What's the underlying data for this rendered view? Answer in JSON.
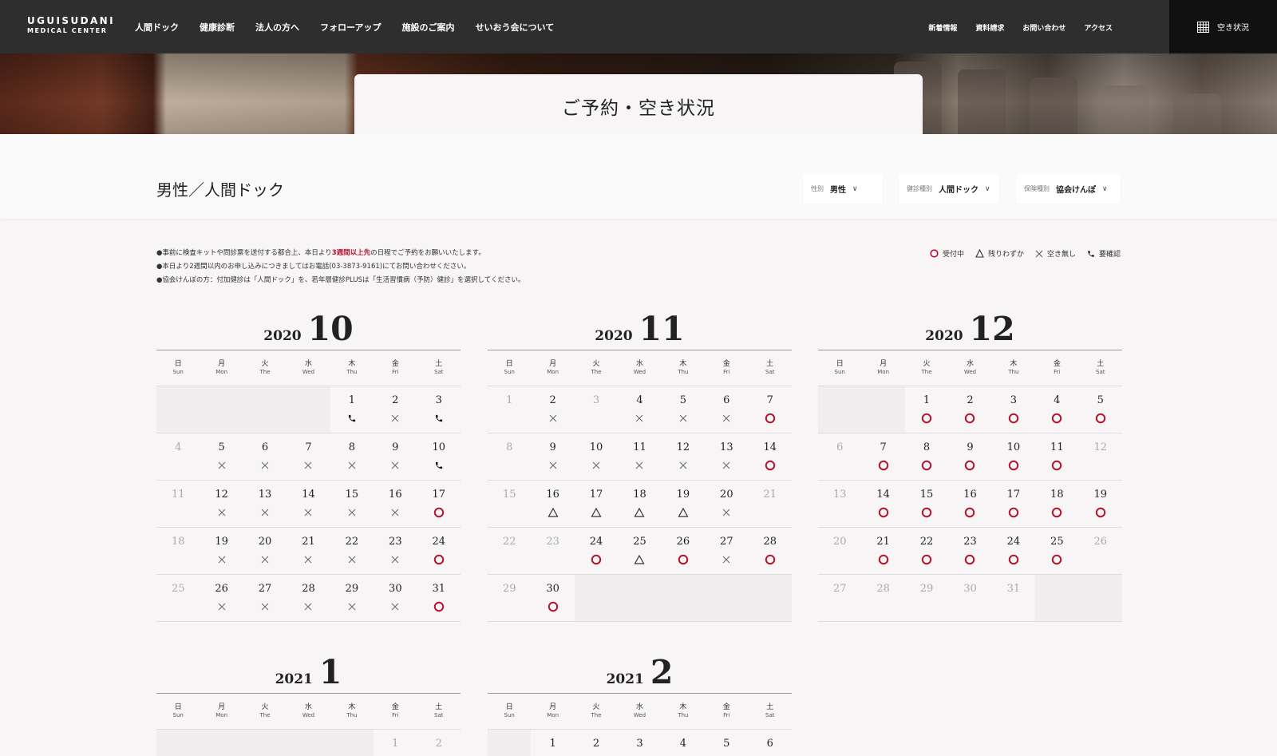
{
  "header": {
    "logo_line1": "UGUISUDANI",
    "logo_line2": "MEDICAL CENTER",
    "main_nav": [
      "人間ドック",
      "健康診断",
      "法人の方へ",
      "フォローアップ",
      "施設のご案内",
      "せいおう会について"
    ],
    "sub_nav": [
      "新着情報",
      "資料請求",
      "お問い合わせ",
      "アクセス"
    ],
    "vacancy_label": "空き状況",
    "vacancy_icon": "calendar-grid-icon"
  },
  "page": {
    "title": "ご予約・空き状況",
    "heading": "男性／人間ドック"
  },
  "filters": [
    {
      "key": "性別",
      "value": "男性"
    },
    {
      "key": "健診種別",
      "value": "人間ドック"
    },
    {
      "key": "保険種別",
      "value": "協会けんぽ"
    }
  ],
  "notes": {
    "line1_pre": "●事前に検査キットや問診票を送付する都合上、本日より",
    "line1_red": "3週間以上先",
    "line1_post": "の日程でご予約をお願いいたします。",
    "line2": "●本日より2週間以内のお申し込みにつきましてはお電話(03-3873-9161)にてお問い合わせください。",
    "line3": "●協会けんぽの方：付加健診は「人間ドック」を、若年層健診PLUSは「生活習慣病（予防）健診」を選択してください。"
  },
  "legend": [
    {
      "icon": "circle",
      "label": "受付中"
    },
    {
      "icon": "triangle",
      "label": "残りわずか"
    },
    {
      "icon": "cross",
      "label": "空き無し"
    },
    {
      "icon": "phone",
      "label": "要確認"
    }
  ],
  "colors": {
    "accent": "#b5122c",
    "header_bg": "#2e2e2e",
    "page_bg": "#f7f5f5"
  },
  "weekdays": [
    {
      "j": "日",
      "e": "Sun"
    },
    {
      "j": "月",
      "e": "Mon"
    },
    {
      "j": "火",
      "e": "The"
    },
    {
      "j": "水",
      "e": "Wed"
    },
    {
      "j": "木",
      "e": "Thu"
    },
    {
      "j": "金",
      "e": "Fri"
    },
    {
      "j": "土",
      "e": "Sat"
    }
  ],
  "months": [
    {
      "year": "2020",
      "month": "10",
      "lead": 4,
      "days": [
        "p",
        "x",
        "p",
        "-",
        "x",
        "x",
        "x",
        "x",
        "x",
        "p",
        "-",
        "x",
        "x",
        "x",
        "x",
        "x",
        "o",
        "-",
        "x",
        "x",
        "x",
        "x",
        "x",
        "o",
        "-",
        "x",
        "x",
        "x",
        "x",
        "x",
        "o"
      ]
    },
    {
      "year": "2020",
      "month": "11",
      "lead": 0,
      "days": [
        "-",
        "x",
        "-",
        "x",
        "x",
        "x",
        "o",
        "-",
        "x",
        "x",
        "x",
        "x",
        "x",
        "o",
        "-",
        "t",
        "t",
        "t",
        "t",
        "x",
        "-",
        "-",
        "-",
        "o",
        "t",
        "o",
        "x",
        "o",
        "-",
        "o"
      ]
    },
    {
      "year": "2020",
      "month": "12",
      "lead": 2,
      "days": [
        "o",
        "o",
        "o",
        "o",
        "o",
        "-",
        "o",
        "o",
        "o",
        "o",
        "o",
        "-",
        "-",
        "o",
        "o",
        "o",
        "o",
        "o",
        "o",
        "-",
        "o",
        "o",
        "o",
        "o",
        "o",
        "-",
        "-",
        "-",
        "-",
        "-",
        "-"
      ]
    },
    {
      "year": "2021",
      "month": "1",
      "lead": 5,
      "days": [
        "-",
        "-"
      ]
    },
    {
      "year": "2021",
      "month": "2",
      "lead": 1,
      "days": [
        "",
        "",
        "",
        "",
        "",
        ""
      ]
    }
  ]
}
